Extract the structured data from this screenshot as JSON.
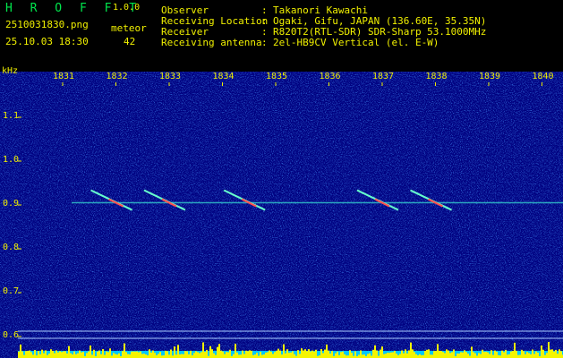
{
  "app": {
    "logo": "H R O F F T",
    "version": "1.0.0"
  },
  "file": {
    "name": "2510031830.png",
    "datetime": "25.10.03 18:30"
  },
  "meteor": {
    "label": "meteor",
    "count": "42"
  },
  "info": [
    {
      "label": "Observer",
      "value": "Takanori Kawachi"
    },
    {
      "label": "Receiving Location",
      "value": "Ogaki, Gifu, JAPAN (136.60E, 35.35N)"
    },
    {
      "label": "Receiver",
      "value": "R820T2(RTL-SDR) SDR-Sharp 53.1000MHz"
    },
    {
      "label": "Receiving antenna",
      "value": "2el-HB9CV Vertical (el. E-W)"
    }
  ],
  "info_separator": ":",
  "colors": {
    "text": "#f0f000",
    "logo": "#00e64d",
    "background": "#000080",
    "signal_line": "#33cccc",
    "histogram": "#f5f500",
    "histogram_base": "#00c8ff"
  },
  "chart_data": {
    "type": "heatmap",
    "xlabel": "",
    "ylabel": "kHz",
    "x_ticks": [
      "1831",
      "1832",
      "1833",
      "1834",
      "1835",
      "1836",
      "1837",
      "1838",
      "1839",
      "1840"
    ],
    "y_ticks": [
      "1.1",
      "1.0",
      "0.9",
      "0.8",
      "0.7",
      "0.6"
    ],
    "ylim": [
      0.6,
      1.15
    ],
    "carrier_khz": 0.905,
    "meteor_echoes": [
      {
        "time": "18:32",
        "khz": 0.905
      },
      {
        "time": "18:33",
        "khz": 0.905
      },
      {
        "time": "18:34:30",
        "khz": 0.905
      },
      {
        "time": "18:37",
        "khz": 0.905
      },
      {
        "time": "18:38",
        "khz": 0.905
      }
    ]
  }
}
